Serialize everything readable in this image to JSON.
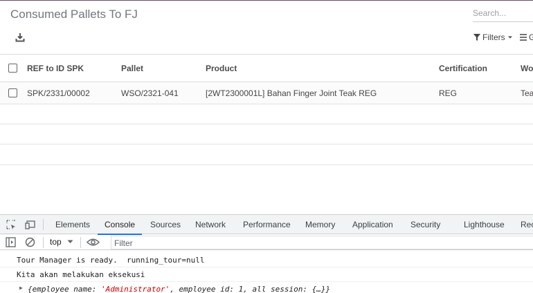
{
  "page": {
    "title": "Consumed Pallets To FJ",
    "search_placeholder": "Search...",
    "filters_label": "Filters",
    "groupby_label": "G"
  },
  "table": {
    "columns": [
      "REF to ID SPK",
      "Pallet",
      "Product",
      "Certification",
      "Wo"
    ],
    "rows": [
      [
        "SPK/2331/00002",
        "WSO/2321-041",
        "[2WT2300001L] Bahan Finger Joint Teak REG",
        "REG",
        "Tea"
      ]
    ]
  },
  "devtools": {
    "tabs": [
      "Elements",
      "Console",
      "Sources",
      "Network",
      "Performance",
      "Memory",
      "Application",
      "Security",
      "Lighthouse",
      "Rec"
    ],
    "active_tab": "Console",
    "context": "top",
    "filter_placeholder": "Filter",
    "logs": [
      "Tour Manager is ready.  running_tour=null",
      "Kita akan melakukan eksekusi"
    ],
    "object_log": {
      "prefix": "{employee_name: ",
      "name_value": "'Administrator'",
      "middle": ", employee_id: 1, all_session: {…}}"
    }
  }
}
